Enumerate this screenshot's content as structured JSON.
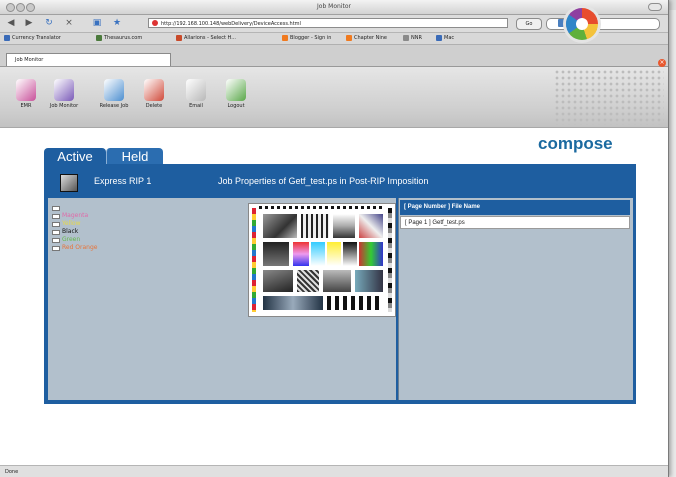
{
  "browser": {
    "window_title": "Job Monitor",
    "url": "http://192.168.100.148/webDelivery/DeviceAccess.html",
    "go_label": "Go",
    "tab_label": "Job Monitor",
    "status": "Done",
    "bookmarks": [
      {
        "label": "Currency Translator",
        "color": "#3a6bb8"
      },
      {
        "label": "Thesaurus.com",
        "color": "#4b7a3c"
      },
      {
        "label": "Allarions - Select H...",
        "color": "#c94a2a"
      },
      {
        "label": "Blogger - Sign in",
        "color": "#f07a1f"
      },
      {
        "label": "Chapter Nine",
        "color": "#f07a1f"
      },
      {
        "label": "NNR",
        "color": "#8a8a8a"
      },
      {
        "label": "Mac",
        "color": "#3a6bb8"
      }
    ]
  },
  "toolbar": {
    "items": [
      {
        "label": "EMR",
        "icon": "emr-icon",
        "color": "#c8509a"
      },
      {
        "label": "Job Monitor",
        "icon": "job-monitor-icon",
        "color": "#7a5ab8"
      },
      {
        "label": "Release Job",
        "icon": "release-job-icon",
        "color": "#4d8fd0"
      },
      {
        "label": "Delete",
        "icon": "delete-icon",
        "color": "#d04a3a"
      },
      {
        "label": "Email",
        "icon": "email-icon",
        "color": "#b8b8b8"
      },
      {
        "label": "Logout",
        "icon": "logout-icon",
        "color": "#5aa84a"
      }
    ]
  },
  "brand": {
    "name": "compose"
  },
  "job_monitor": {
    "tabs": [
      "Active",
      "Held"
    ],
    "rip_name": "Express RIP 1",
    "job_title": "Job Properties of Getf_test.ps in Post-RIP Imposition",
    "separations": [
      {
        "label": "",
        "color": "#ffffff"
      },
      {
        "label": "Magenta",
        "color": "#e06aa8"
      },
      {
        "label": "Yellow",
        "color": "#e6d84a"
      },
      {
        "label": "Black",
        "color": "#111111"
      },
      {
        "label": "Green",
        "color": "#64b84a"
      },
      {
        "label": "Red Orange",
        "color": "#e8743a"
      }
    ],
    "list_header": "[ Page Number ] File Name",
    "pages": [
      {
        "label": "[ Page 1 ] Getf_test.ps"
      }
    ]
  }
}
